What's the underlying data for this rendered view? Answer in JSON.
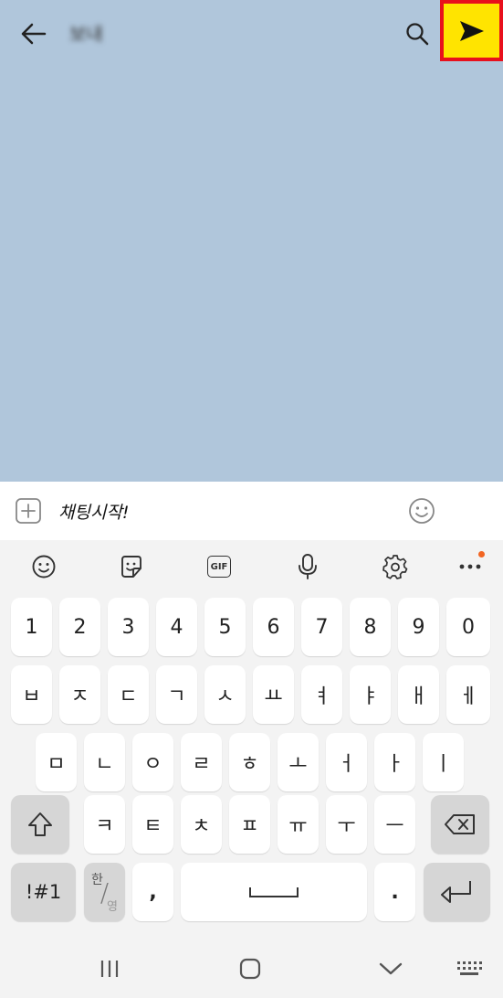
{
  "header": {
    "title": "보내",
    "back_icon": "arrow-left-icon",
    "search_icon": "search-icon",
    "menu_icon": "hamburger-menu-icon"
  },
  "input_bar": {
    "value": "채팅시작!",
    "plus_icon": "plus-box-icon",
    "emoji_icon": "emoji-icon",
    "send_icon": "send-arrow-icon",
    "send_bg_color": "#ffe400",
    "highlight_color": "#e8101c"
  },
  "toolbar": {
    "items": [
      "emoji-icon",
      "sticker-icon",
      "gif-icon",
      "microphone-icon",
      "settings-gear-icon",
      "more-dots-icon"
    ],
    "gif_label": "GIF"
  },
  "keyboard": {
    "row1": [
      "1",
      "2",
      "3",
      "4",
      "5",
      "6",
      "7",
      "8",
      "9",
      "0"
    ],
    "row2": [
      "ㅂ",
      "ㅈ",
      "ㄷ",
      "ㄱ",
      "ㅅ",
      "ㅛ",
      "ㅕ",
      "ㅑ",
      "ㅐ",
      "ㅔ"
    ],
    "row3": [
      "ㅁ",
      "ㄴ",
      "ㅇ",
      "ㄹ",
      "ㅎ",
      "ㅗ",
      "ㅓ",
      "ㅏ",
      "ㅣ"
    ],
    "row4": [
      "ㅋ",
      "ㅌ",
      "ㅊ",
      "ㅍ",
      "ㅠ",
      "ㅜ",
      "ㅡ"
    ],
    "symbols_label": "!#1",
    "lang_top": "한",
    "lang_bottom": "영",
    "lang_slash": "/",
    "comma": ",",
    "period": "."
  },
  "navbar": {
    "recents_icon": "recent-apps-icon",
    "home_icon": "home-icon",
    "back_icon": "chevron-down-icon",
    "keyboard_icon": "keyboard-grid-icon"
  }
}
